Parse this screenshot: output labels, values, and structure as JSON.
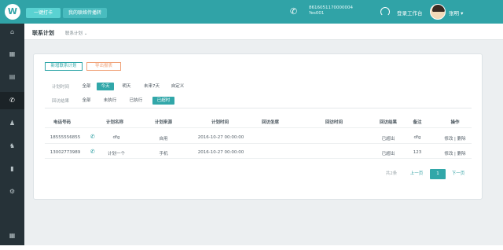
{
  "topbar": {
    "logo_letter": "W",
    "btn_a": "一键打卡",
    "btn_b": "我的联络传播转",
    "phone_number": "8616051170000004",
    "phone_sub": "Yes001",
    "status": "登录工作台",
    "username": "张明 ▾"
  },
  "sidebar": {
    "items": [
      {
        "icon": "home-icon",
        "glyph": "⌂"
      },
      {
        "icon": "grid-icon",
        "glyph": "▦"
      },
      {
        "icon": "doc-icon",
        "glyph": "▤"
      },
      {
        "icon": "phone-icon",
        "glyph": "✆"
      },
      {
        "icon": "user-icon",
        "glyph": "♟"
      },
      {
        "icon": "users-icon",
        "glyph": "♞"
      },
      {
        "icon": "chart-icon",
        "glyph": "▮"
      },
      {
        "icon": "settings-icon",
        "glyph": "⚙"
      },
      {
        "icon": "apps-icon",
        "glyph": "▦"
      }
    ]
  },
  "page": {
    "title": "联系计划",
    "breadcrumb": "联系计划  ⌄"
  },
  "toolbar": {
    "new_label": "新增联系计划",
    "export_label": "导出报表"
  },
  "filters": {
    "time_label": "计划时间",
    "time_options": [
      "全部",
      "今天",
      "明天",
      "未来7天",
      "自定义"
    ],
    "time_selected": 1,
    "status_label": "回访结果",
    "status_options": [
      "全部",
      "未执行",
      "已执行",
      "已超时"
    ],
    "status_selected": 3
  },
  "table": {
    "headers": [
      "电话号码",
      "计划名称",
      "计划来源",
      "计划时间",
      "回访坐席",
      "回访时间",
      "回访结果",
      "备注",
      "操作"
    ],
    "rows": [
      {
        "phone": "18555556855",
        "name": "dfg",
        "source": "自用",
        "time": "2016-10-27 00:00:00",
        "agent": "",
        "visit_time": "",
        "result": "已超出",
        "remark": "dfg",
        "ops": "修改 | 删除"
      },
      {
        "phone": "13002773989",
        "name": "计划一个",
        "source": "手机",
        "time": "2016-10-27 00:00:00",
        "agent": "",
        "visit_time": "",
        "result": "已超出",
        "remark": "123",
        "ops": "修改 | 删除"
      }
    ]
  },
  "pagination": {
    "total": "共2条",
    "prev": "上一页",
    "current": "1",
    "next": "下一页"
  }
}
